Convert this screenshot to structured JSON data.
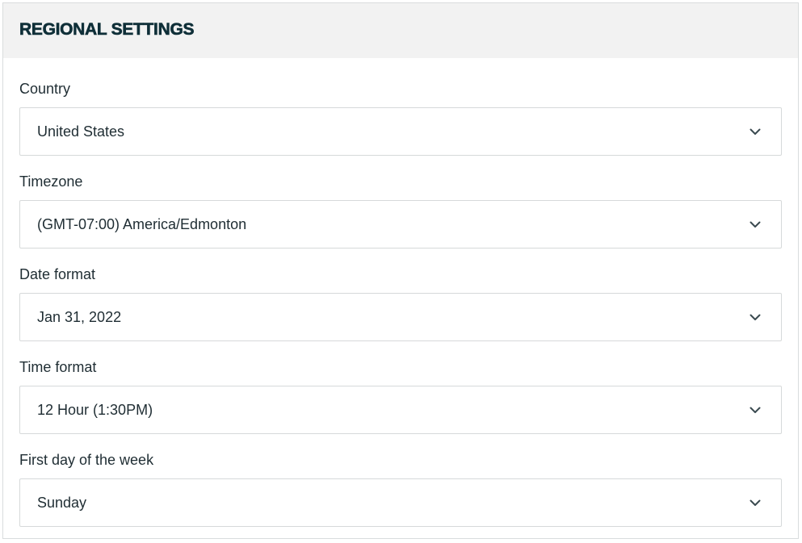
{
  "header": {
    "title": "REGIONAL SETTINGS"
  },
  "fields": [
    {
      "label": "Country",
      "value": "United States",
      "icon": "chevron-down-icon"
    },
    {
      "label": "Timezone",
      "value": "(GMT-07:00) America/Edmonton",
      "icon": "chevron-down-icon"
    },
    {
      "label": "Date format",
      "value": "Jan 31, 2022",
      "icon": "chevron-down-icon"
    },
    {
      "label": "Time format",
      "value": "12 Hour (1:30PM)",
      "icon": "chevron-down-icon"
    },
    {
      "label": "First day of the week",
      "value": "Sunday",
      "icon": "chevron-down-icon"
    }
  ],
  "colors": {
    "header_bg": "#f2f2f2",
    "title_text": "#0f2f38",
    "body_text": "#1f2d33",
    "border": "#d6d9da"
  }
}
